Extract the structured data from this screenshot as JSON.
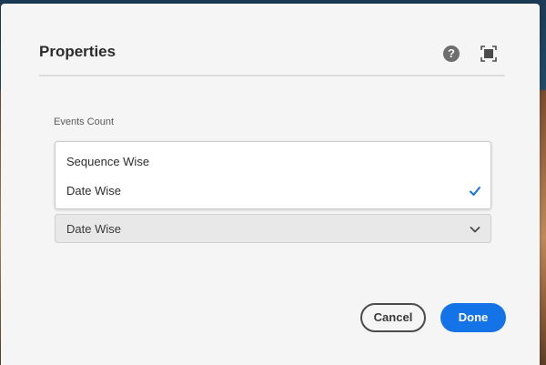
{
  "dialog": {
    "title": "Properties",
    "help_icon": "help-icon",
    "fullscreen_icon": "fullscreen-icon"
  },
  "events_count": {
    "label": "Events Count",
    "options": [
      {
        "label": "Sequence Wise",
        "selected": false
      },
      {
        "label": "Date Wise",
        "selected": true
      }
    ],
    "selected_value": "Date Wise"
  },
  "footer": {
    "cancel_label": "Cancel",
    "done_label": "Done"
  },
  "colors": {
    "accent": "#1473e6",
    "dialog_bg": "#f5f5f5"
  }
}
